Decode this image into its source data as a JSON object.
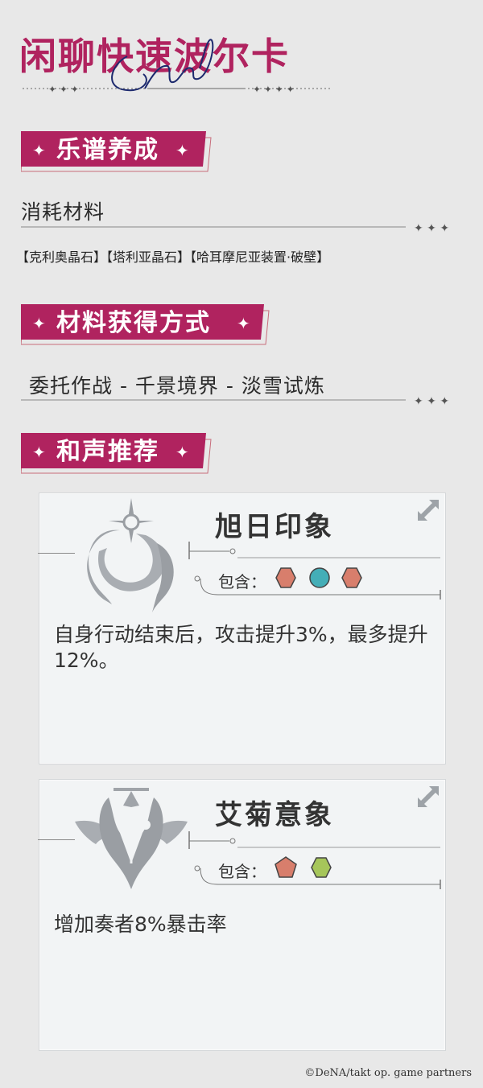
{
  "header": {
    "title": "闲聊快速波尔卡",
    "script_overlay": "Chorus"
  },
  "sections": {
    "score": {
      "label": "乐谱养成",
      "subhead": "消耗材料",
      "materials": "【克利奥晶石】【塔利亚晶石】【哈耳摩尼亚装置·破壁】"
    },
    "obtain": {
      "label": "材料获得方式",
      "subhead": "委托作战 - 千景境界 - 淡雪试炼"
    },
    "harmony": {
      "label": "和声推荐"
    }
  },
  "cards": [
    {
      "name": "旭日印象",
      "contains_label": "包含：",
      "gems": [
        {
          "shape": "hexagon",
          "color": "#d87e6c"
        },
        {
          "shape": "circle",
          "color": "#44aeb7"
        },
        {
          "shape": "hexagon",
          "color": "#d87e6c"
        }
      ],
      "description": "自身行动结束后，攻击提升3%，最多提升12%。",
      "emblem_icon": "sun-emblem-icon"
    },
    {
      "name": "艾菊意象",
      "contains_label": "包含：",
      "gems": [
        {
          "shape": "pentagon",
          "color": "#d87e6c"
        },
        {
          "shape": "hexagon",
          "color": "#a6c65a"
        }
      ],
      "description": "增加奏者8%暴击率",
      "emblem_icon": "tansy-emblem-icon"
    }
  ],
  "footer": {
    "copyright": "©DeNA/takt op. game partners"
  },
  "colors": {
    "accent": "#b0235f",
    "background": "#e8e8e8",
    "card_bg": "#f2f4f5"
  }
}
